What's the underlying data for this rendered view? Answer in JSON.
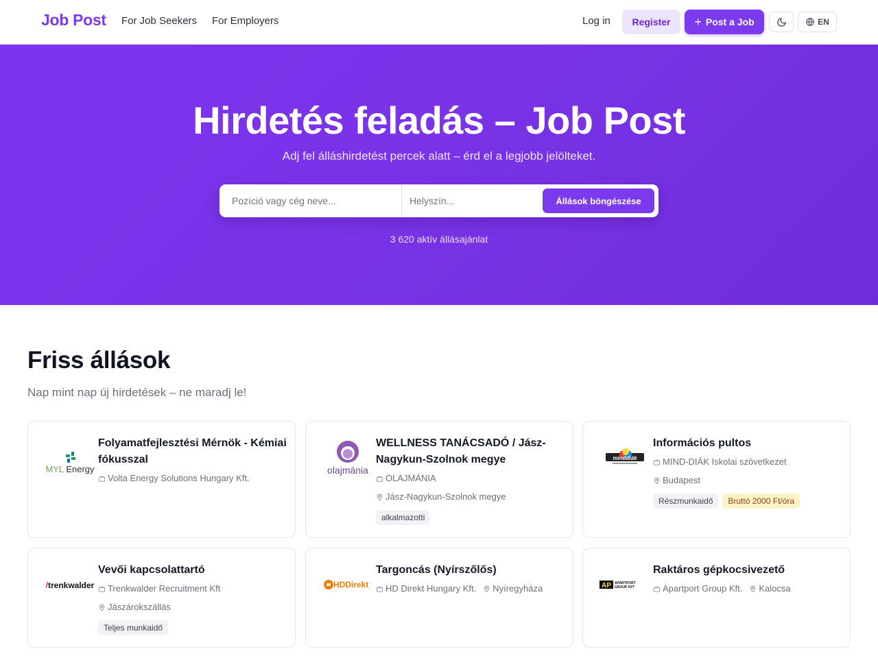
{
  "nav": {
    "brand": "Job Post",
    "links": [
      "For Job Seekers",
      "For Employers"
    ],
    "login": "Log in",
    "register": "Register",
    "post_job": "Post a Job",
    "theme_icon": "moon-icon",
    "language": "EN"
  },
  "hero": {
    "title": "Hirdetés feladás – Job Post",
    "subtitle": "Adj fel álláshirdetést percek alatt – érd el a legjobb jelölteket.",
    "search_placeholder": "Pozíció vagy cég neve...",
    "location_placeholder": "Helyszín...",
    "browse_button": "Állások böngészése",
    "active_count": "3 620 aktív állásajánlat",
    "colors": {
      "accent": "#7c3aed"
    }
  },
  "section": {
    "title": "Friss állások",
    "subtitle": "Nap mint nap új hirdetések – ne maradj le!"
  },
  "jobs": [
    {
      "title": "Folyamatfejlesztési Mérnök - Kémiai fókusszal",
      "company": "Volta Energy Solutions Hungary Kft.",
      "location": "",
      "tags": [],
      "pay": "",
      "logo_text": "MYL Energy"
    },
    {
      "title": "WELLNESS TANÁCSADÓ / Jász-Nagykun-Szolnok megye",
      "company": "OLAJMÁNIA",
      "location": "Jász-Nagykun-Szolnok megye",
      "tags": [
        "alkalmazotti"
      ],
      "pay": "",
      "logo_text": "olajmánia"
    },
    {
      "title": "Információs pultos",
      "company": "MIND-DIÁK Iskolai szövetkezet",
      "location": "Budapest",
      "tags": [
        "Részmunkaidő"
      ],
      "pay": "Bruttó 2000 Ft/óra",
      "logo_text": "minddiák"
    },
    {
      "title": "Vevői kapcsolattartó",
      "company": "Trenkwalder Recruitment Kft",
      "location": "Jászárokszállás",
      "tags": [
        "Teljes munkaidő"
      ],
      "pay": "",
      "logo_text": "/trenkwalder"
    },
    {
      "title": "Targoncás (Nyírszőlős)",
      "company": "HD Direkt Hungary Kft.",
      "location": "Nyíregyháza",
      "tags": [],
      "pay": "",
      "logo_text": "HDDirekt"
    },
    {
      "title": "Raktáros gépkocsivezető",
      "company": "Apartport Group Kft.",
      "location": "Kalocsa",
      "tags": [],
      "pay": "",
      "logo_text": "AP APARTPORT GROUP KFT"
    }
  ]
}
